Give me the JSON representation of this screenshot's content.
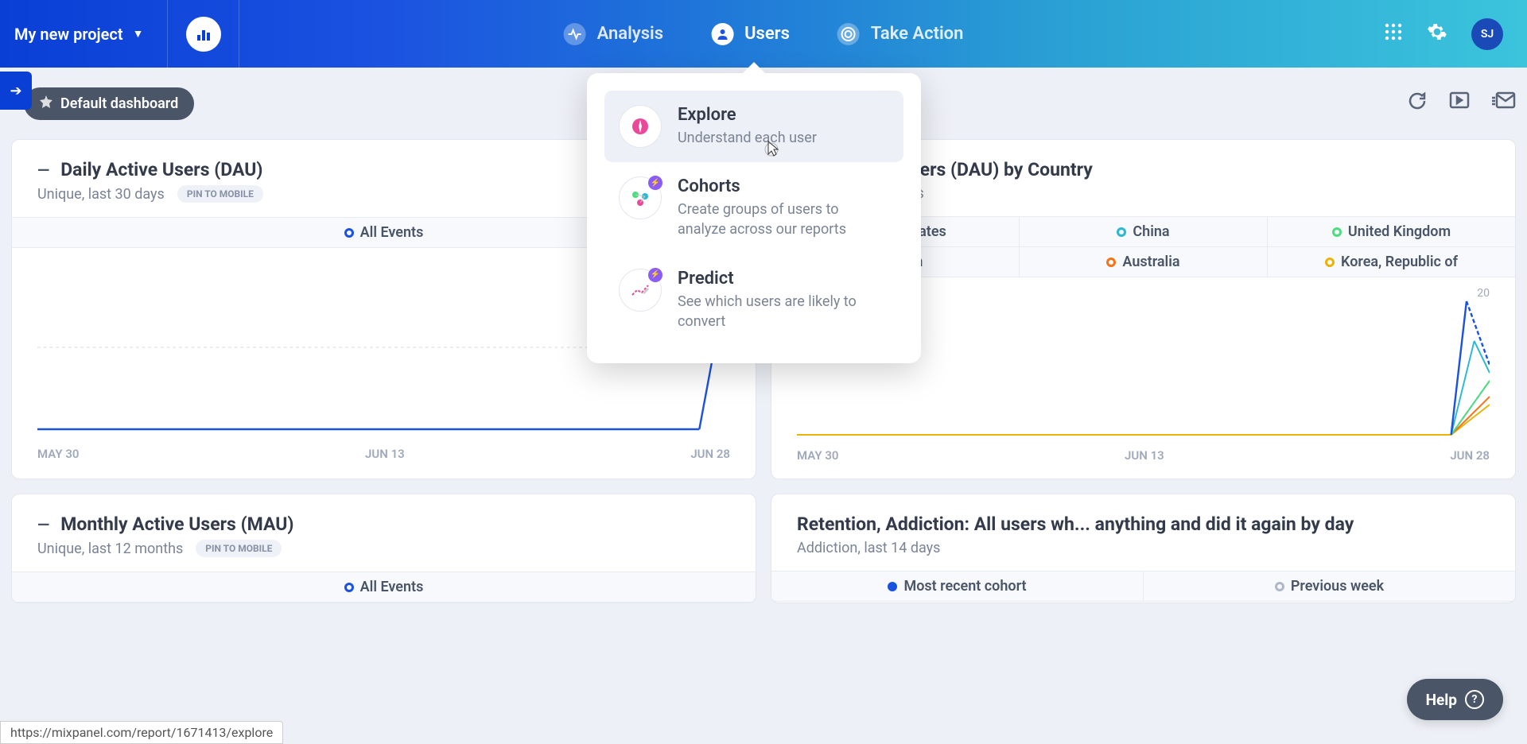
{
  "header": {
    "project_name": "My new project",
    "nav": {
      "analysis": "Analysis",
      "users": "Users",
      "take_action": "Take Action"
    },
    "avatar": "SJ"
  },
  "dashboard": {
    "default_label": "Default dashboard",
    "side_arrow": "➔"
  },
  "dropdown": {
    "items": [
      {
        "title": "Explore",
        "desc": "Understand each user",
        "icon": "compass"
      },
      {
        "title": "Cohorts",
        "desc": "Create groups of users to analyze across our reports",
        "icon": "nodes"
      },
      {
        "title": "Predict",
        "desc": "See which users are likely to convert",
        "icon": "trend"
      }
    ]
  },
  "cards": [
    {
      "title": "Daily Active Users (DAU)",
      "subtitle": "Unique, last 30 days",
      "pin": "PIN TO MOBILE",
      "legend": [
        {
          "label": "All Events",
          "color": "#1b52e0"
        }
      ],
      "axis": {
        "left": "MAY 30",
        "mid": "JUN 13",
        "right": "JUN 28"
      }
    },
    {
      "title": "Daily Active Users (DAU) by Country",
      "subtitle": "Unique, last 30 days",
      "legend_rows": [
        [
          {
            "label": "United States",
            "color": "#1b52e0"
          },
          {
            "label": "China",
            "color": "#2ab8d4"
          },
          {
            "label": "United Kingdom",
            "color": "#4ade80"
          }
        ],
        [
          {
            "label": "Japan",
            "color": "#8b5cf6"
          },
          {
            "label": "Australia",
            "color": "#f97316"
          },
          {
            "label": "Korea, Republic of",
            "color": "#eab308"
          }
        ]
      ],
      "axis": {
        "left": "MAY 30",
        "mid": "JUN 13",
        "right": "JUN 28"
      },
      "y_top": "20"
    },
    {
      "title": "Monthly Active Users (MAU)",
      "subtitle": "Unique, last 12 months",
      "pin": "PIN TO MOBILE",
      "legend": [
        {
          "label": "All Events",
          "color": "#1b52e0"
        }
      ]
    },
    {
      "title": "Retention, Addiction: All users wh... anything and did it again by day",
      "subtitle": "Addiction, last 14 days",
      "legend": [
        {
          "label": "Most recent cohort",
          "color": "#1b52e0",
          "filled": true
        },
        {
          "label": "Previous week",
          "color": "#b0b8c8",
          "filled": false
        }
      ]
    }
  ],
  "chart_data": [
    {
      "type": "line",
      "title": "Daily Active Users (DAU)",
      "xlabel": "",
      "ylabel": "",
      "x_ticks": [
        "MAY 30",
        "JUN 13",
        "JUN 28"
      ],
      "ylim": [
        0,
        250
      ],
      "series": [
        {
          "name": "All Events",
          "x_range": [
            "MAY 30",
            "JUN 28"
          ],
          "values_note": "Flat at ~0 from May 30 through ~Jun 27, then spikes sharply upward at Jun 28 (value off-scale / partial)",
          "values": [
            0,
            0,
            0,
            0,
            0,
            0,
            0,
            0,
            0,
            0,
            0,
            0,
            0,
            0,
            0,
            0,
            0,
            0,
            0,
            0,
            0,
            0,
            0,
            0,
            0,
            0,
            0,
            0,
            0,
            250
          ]
        }
      ]
    },
    {
      "type": "line",
      "title": "Daily Active Users (DAU) by Country",
      "xlabel": "",
      "ylabel": "",
      "x_ticks": [
        "MAY 30",
        "JUN 13",
        "JUN 28"
      ],
      "ylim": [
        0,
        20
      ],
      "series": [
        {
          "name": "United States",
          "color": "#1b52e0",
          "values_note": "Flat 0 then spike near Jun 28 to ~20",
          "values": [
            0,
            0,
            0,
            0,
            0,
            0,
            0,
            0,
            0,
            0,
            0,
            0,
            0,
            0,
            0,
            0,
            0,
            0,
            0,
            0,
            0,
            0,
            0,
            0,
            0,
            0,
            0,
            0,
            0,
            20
          ]
        },
        {
          "name": "China",
          "color": "#2ab8d4",
          "values_note": "Flat 0 then spike near Jun 28 to ~15",
          "values": [
            0,
            0,
            0,
            0,
            0,
            0,
            0,
            0,
            0,
            0,
            0,
            0,
            0,
            0,
            0,
            0,
            0,
            0,
            0,
            0,
            0,
            0,
            0,
            0,
            0,
            0,
            0,
            0,
            0,
            15
          ]
        },
        {
          "name": "United Kingdom",
          "color": "#4ade80",
          "values_note": "Flat 0 then spike near Jun 28 to ~7",
          "values": [
            0,
            0,
            0,
            0,
            0,
            0,
            0,
            0,
            0,
            0,
            0,
            0,
            0,
            0,
            0,
            0,
            0,
            0,
            0,
            0,
            0,
            0,
            0,
            0,
            0,
            0,
            0,
            0,
            0,
            7
          ]
        },
        {
          "name": "Japan",
          "color": "#8b5cf6",
          "values_note": "Flat 0 then spike near Jun 28 to ~7",
          "values": [
            0,
            0,
            0,
            0,
            0,
            0,
            0,
            0,
            0,
            0,
            0,
            0,
            0,
            0,
            0,
            0,
            0,
            0,
            0,
            0,
            0,
            0,
            0,
            0,
            0,
            0,
            0,
            0,
            0,
            7
          ]
        },
        {
          "name": "Australia",
          "color": "#f97316",
          "values_note": "Flat 0 then spike near Jun 28 to ~5",
          "values": [
            0,
            0,
            0,
            0,
            0,
            0,
            0,
            0,
            0,
            0,
            0,
            0,
            0,
            0,
            0,
            0,
            0,
            0,
            0,
            0,
            0,
            0,
            0,
            0,
            0,
            0,
            0,
            0,
            0,
            5
          ]
        },
        {
          "name": "Korea, Republic of",
          "color": "#eab308",
          "values_note": "Flat 0 then spike near Jun 28 to ~5",
          "values": [
            0,
            0,
            0,
            0,
            0,
            0,
            0,
            0,
            0,
            0,
            0,
            0,
            0,
            0,
            0,
            0,
            0,
            0,
            0,
            0,
            0,
            0,
            0,
            0,
            0,
            0,
            0,
            0,
            0,
            5
          ]
        }
      ]
    }
  ],
  "help": {
    "label": "Help"
  },
  "status_url": "https://mixpanel.com/report/1671413/explore"
}
